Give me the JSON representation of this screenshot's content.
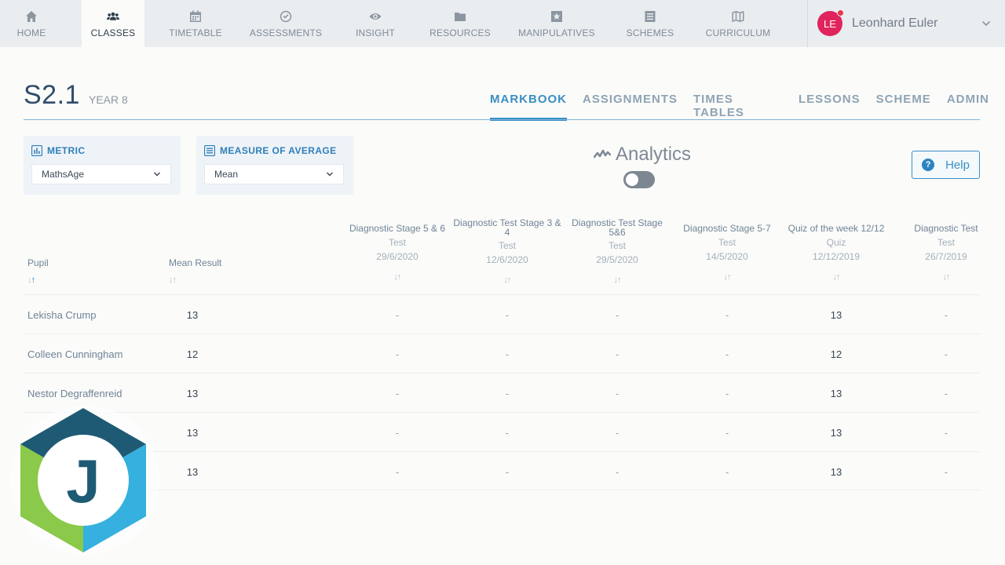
{
  "nav": {
    "items": [
      {
        "label": "HOME",
        "icon": "home-icon"
      },
      {
        "label": "CLASSES",
        "icon": "users-icon"
      },
      {
        "label": "TIMETABLE",
        "icon": "calendar-icon"
      },
      {
        "label": "ASSESSMENTS",
        "icon": "check-circle-icon"
      },
      {
        "label": "INSIGHT",
        "icon": "eye-icon"
      },
      {
        "label": "RESOURCES",
        "icon": "folder-icon"
      },
      {
        "label": "MANIPULATIVES",
        "icon": "star-box-icon"
      },
      {
        "label": "SCHEMES",
        "icon": "list-icon"
      },
      {
        "label": "CURRICULUM",
        "icon": "map-icon"
      }
    ],
    "active": "CLASSES",
    "user": {
      "initials": "LE",
      "name": "Leonhard Euler"
    }
  },
  "header": {
    "title": "S2.1",
    "year": "YEAR 8",
    "tabs": [
      "MARKBOOK",
      "ASSIGNMENTS",
      "TIMES TABLES",
      "LESSONS",
      "SCHEME",
      "ADMIN"
    ],
    "active_tab": "MARKBOOK"
  },
  "filters": {
    "metric": {
      "label": "METRIC",
      "value": "MathsAge"
    },
    "average": {
      "label": "MEASURE OF AVERAGE",
      "value": "Mean"
    }
  },
  "analytics": {
    "label": "Analytics",
    "enabled": false
  },
  "help": {
    "label": "Help"
  },
  "table": {
    "pupil_header": "Pupil",
    "mean_header": "Mean Result",
    "sort_glyph": "↓↑",
    "columns": [
      {
        "title": "Diagnostic Stage 5 & 6",
        "type": "Test",
        "date": "29/6/2020"
      },
      {
        "title": "Diagnostic Test Stage 3 & 4",
        "type": "Test",
        "date": "12/6/2020"
      },
      {
        "title": "Diagnostic Test Stage 5&6",
        "type": "Test",
        "date": "29/5/2020"
      },
      {
        "title": "Diagnostic Stage 5-7",
        "type": "Test",
        "date": "14/5/2020"
      },
      {
        "title": "Quiz of the week 12/12",
        "type": "Quiz",
        "date": "12/12/2019"
      },
      {
        "title": "Diagnostic Test",
        "type": "Test",
        "date": "26/7/2019"
      }
    ],
    "rows": [
      {
        "name": "Lekisha Crump",
        "mean": "13",
        "cells": [
          "-",
          "-",
          "-",
          "-",
          "13",
          "-"
        ]
      },
      {
        "name": "Colleen Cunningham",
        "mean": "12",
        "cells": [
          "-",
          "-",
          "-",
          "-",
          "12",
          "-"
        ]
      },
      {
        "name": "Nestor Degraffenreid",
        "mean": "13",
        "cells": [
          "-",
          "-",
          "-",
          "-",
          "13",
          "-"
        ]
      },
      {
        "name": "",
        "mean": "13",
        "cells": [
          "-",
          "-",
          "-",
          "-",
          "13",
          "-"
        ]
      },
      {
        "name": "",
        "mean": "13",
        "cells": [
          "-",
          "-",
          "-",
          "-",
          "13",
          "-"
        ]
      }
    ]
  },
  "logo": {
    "letter": "J"
  },
  "colors": {
    "accent": "#3a8fc4",
    "avatar": "#e0245e",
    "nav_bg": "#eaedf0"
  }
}
